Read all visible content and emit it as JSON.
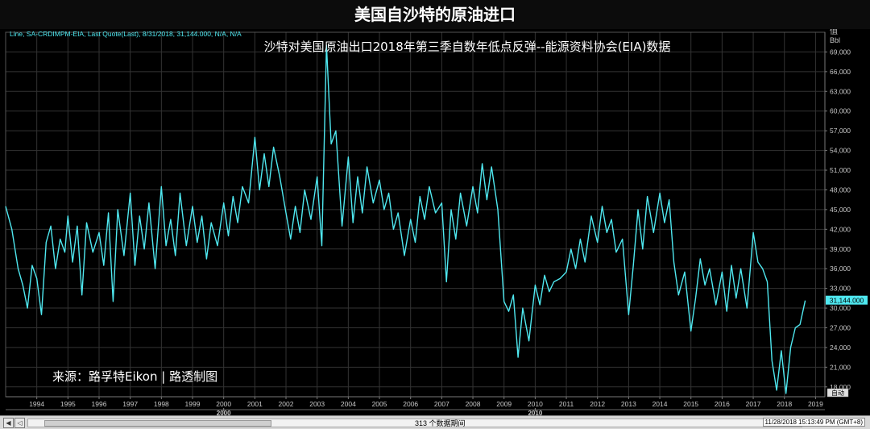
{
  "title": "美国自沙特的原油进口",
  "legend": "Line, SA-CRDIMPM-EIA, Last Quote(Last), 8/31/2018, 31,144.000, N/A, N/A",
  "subtitle": "沙特对美国原油出口2018年第三季自数年低点反弹--能源资料协会(EIA)数据",
  "source": "来源：路孚特Eikon | 路透制图",
  "y_unit_1": "值",
  "y_unit_2": "Bbl",
  "auto_label": "自动",
  "last_value_label": "31,144.000",
  "decades": [
    {
      "label": "1990",
      "year": 1990
    },
    {
      "label": "2000",
      "year": 2000
    },
    {
      "label": "2010",
      "year": 2010
    }
  ],
  "footer": {
    "points_label": "313 个数据期间",
    "timestamp": "11/28/2018 15:13:49 PM (GMT+8)"
  },
  "colors": {
    "line": "#4fe8f0",
    "background": "#000000",
    "grid": "#333333",
    "text": "#ffffff",
    "axis_text": "#c8c8c8",
    "legend_text": "#4fe8f0"
  },
  "chart_data": {
    "type": "line",
    "title": "美国自沙特的原油进口",
    "subtitle": "沙特对美国原油出口2018年第三季自数年低点反弹--能源资料协会(EIA)数据",
    "series": [
      {
        "name": "SA-CRDIMPM-EIA"
      }
    ],
    "ylabel": "值 Bbl",
    "ylim": [
      16500,
      72000
    ],
    "yticks": [
      18000,
      21000,
      24000,
      27000,
      30000,
      33000,
      36000,
      39000,
      42000,
      45000,
      48000,
      51000,
      54000,
      57000,
      60000,
      63000,
      66000,
      69000
    ],
    "ytick_labels": [
      "18,000",
      "21,000",
      "24,000",
      "27,000",
      "30,000",
      "33,000",
      "36,000",
      "39,000",
      "42,000",
      "45,000",
      "48,000",
      "51,000",
      "54,000",
      "57,000",
      "60,000",
      "63,000",
      "66,000",
      "69,000"
    ],
    "xlim": [
      1993.0,
      2019.3
    ],
    "xticks": [
      1994,
      1995,
      1996,
      1997,
      1998,
      1999,
      2000,
      2001,
      2002,
      2003,
      2004,
      2005,
      2006,
      2007,
      2008,
      2009,
      2010,
      2011,
      2012,
      2013,
      2014,
      2015,
      2016,
      2017,
      2018,
      2019
    ],
    "xtick_labels": [
      "1994",
      "1995",
      "1996",
      "1997",
      "1998",
      "1999",
      "2000",
      "2001",
      "2002",
      "2003",
      "2004",
      "2005",
      "2006",
      "2007",
      "2008",
      "2009",
      "2010",
      "2011",
      "2012",
      "2013",
      "2014",
      "2015",
      "2016",
      "2017",
      "2018",
      "2019"
    ],
    "grid": true,
    "last_value": 31144,
    "points": [
      [
        1993.0,
        45500
      ],
      [
        1993.2,
        42000
      ],
      [
        1993.4,
        36000
      ],
      [
        1993.55,
        33500
      ],
      [
        1993.7,
        30000
      ],
      [
        1993.85,
        36500
      ],
      [
        1994.0,
        34500
      ],
      [
        1994.15,
        29000
      ],
      [
        1994.3,
        40000
      ],
      [
        1994.45,
        42500
      ],
      [
        1994.6,
        36000
      ],
      [
        1994.75,
        40500
      ],
      [
        1994.9,
        38500
      ],
      [
        1995.0,
        44000
      ],
      [
        1995.15,
        37000
      ],
      [
        1995.3,
        42500
      ],
      [
        1995.45,
        32000
      ],
      [
        1995.6,
        43000
      ],
      [
        1995.8,
        38500
      ],
      [
        1996.0,
        41500
      ],
      [
        1996.15,
        36500
      ],
      [
        1996.3,
        44500
      ],
      [
        1996.45,
        31000
      ],
      [
        1996.6,
        45000
      ],
      [
        1996.8,
        38000
      ],
      [
        1997.0,
        47500
      ],
      [
        1997.15,
        36500
      ],
      [
        1997.3,
        44000
      ],
      [
        1997.45,
        39000
      ],
      [
        1997.6,
        46000
      ],
      [
        1997.8,
        36000
      ],
      [
        1998.0,
        48500
      ],
      [
        1998.15,
        39500
      ],
      [
        1998.3,
        43500
      ],
      [
        1998.45,
        38000
      ],
      [
        1998.6,
        47500
      ],
      [
        1998.8,
        39500
      ],
      [
        1999.0,
        45500
      ],
      [
        1999.15,
        40000
      ],
      [
        1999.3,
        44000
      ],
      [
        1999.45,
        37500
      ],
      [
        1999.6,
        43000
      ],
      [
        1999.8,
        39500
      ],
      [
        2000.0,
        46000
      ],
      [
        2000.15,
        41000
      ],
      [
        2000.3,
        47000
      ],
      [
        2000.45,
        43000
      ],
      [
        2000.6,
        48500
      ],
      [
        2000.8,
        46000
      ],
      [
        2001.0,
        56000
      ],
      [
        2001.15,
        48000
      ],
      [
        2001.3,
        53500
      ],
      [
        2001.45,
        48500
      ],
      [
        2001.6,
        54500
      ],
      [
        2001.8,
        50000
      ],
      [
        2002.0,
        44500
      ],
      [
        2002.15,
        40500
      ],
      [
        2002.3,
        45500
      ],
      [
        2002.45,
        41500
      ],
      [
        2002.6,
        48000
      ],
      [
        2002.8,
        43500
      ],
      [
        2003.0,
        50000
      ],
      [
        2003.15,
        39500
      ],
      [
        2003.3,
        70000
      ],
      [
        2003.45,
        55000
      ],
      [
        2003.6,
        57000
      ],
      [
        2003.8,
        42500
      ],
      [
        2004.0,
        53000
      ],
      [
        2004.15,
        43000
      ],
      [
        2004.3,
        50000
      ],
      [
        2004.45,
        44500
      ],
      [
        2004.6,
        51500
      ],
      [
        2004.8,
        46000
      ],
      [
        2005.0,
        49500
      ],
      [
        2005.15,
        45000
      ],
      [
        2005.3,
        47500
      ],
      [
        2005.45,
        42000
      ],
      [
        2005.6,
        44500
      ],
      [
        2005.8,
        38000
      ],
      [
        2006.0,
        43500
      ],
      [
        2006.15,
        40000
      ],
      [
        2006.3,
        47000
      ],
      [
        2006.45,
        43500
      ],
      [
        2006.6,
        48500
      ],
      [
        2006.8,
        44500
      ],
      [
        2007.0,
        46000
      ],
      [
        2007.15,
        34000
      ],
      [
        2007.3,
        45000
      ],
      [
        2007.45,
        40500
      ],
      [
        2007.6,
        47500
      ],
      [
        2007.8,
        42500
      ],
      [
        2008.0,
        48500
      ],
      [
        2008.15,
        44500
      ],
      [
        2008.3,
        52000
      ],
      [
        2008.45,
        46500
      ],
      [
        2008.6,
        51500
      ],
      [
        2008.8,
        45000
      ],
      [
        2009.0,
        31000
      ],
      [
        2009.15,
        29500
      ],
      [
        2009.3,
        32000
      ],
      [
        2009.45,
        22500
      ],
      [
        2009.6,
        30000
      ],
      [
        2009.8,
        25000
      ],
      [
        2010.0,
        33500
      ],
      [
        2010.15,
        30500
      ],
      [
        2010.3,
        35000
      ],
      [
        2010.45,
        32500
      ],
      [
        2010.6,
        34000
      ],
      [
        2010.8,
        34500
      ],
      [
        2011.0,
        35500
      ],
      [
        2011.15,
        39000
      ],
      [
        2011.3,
        36000
      ],
      [
        2011.45,
        40500
      ],
      [
        2011.6,
        37000
      ],
      [
        2011.8,
        44000
      ],
      [
        2012.0,
        40000
      ],
      [
        2012.15,
        45500
      ],
      [
        2012.3,
        41500
      ],
      [
        2012.45,
        43500
      ],
      [
        2012.6,
        38500
      ],
      [
        2012.8,
        40500
      ],
      [
        2013.0,
        29000
      ],
      [
        2013.15,
        36500
      ],
      [
        2013.3,
        45000
      ],
      [
        2013.45,
        39000
      ],
      [
        2013.6,
        47000
      ],
      [
        2013.8,
        41500
      ],
      [
        2014.0,
        47500
      ],
      [
        2014.15,
        43000
      ],
      [
        2014.3,
        46500
      ],
      [
        2014.45,
        37000
      ],
      [
        2014.6,
        32000
      ],
      [
        2014.8,
        35500
      ],
      [
        2015.0,
        26500
      ],
      [
        2015.15,
        31500
      ],
      [
        2015.3,
        37500
      ],
      [
        2015.45,
        33500
      ],
      [
        2015.6,
        36000
      ],
      [
        2015.8,
        30500
      ],
      [
        2016.0,
        35500
      ],
      [
        2016.15,
        29500
      ],
      [
        2016.3,
        36500
      ],
      [
        2016.45,
        31500
      ],
      [
        2016.6,
        36000
      ],
      [
        2016.8,
        30000
      ],
      [
        2017.0,
        41500
      ],
      [
        2017.15,
        37000
      ],
      [
        2017.3,
        36000
      ],
      [
        2017.45,
        34000
      ],
      [
        2017.6,
        22000
      ],
      [
        2017.75,
        17500
      ],
      [
        2017.9,
        23500
      ],
      [
        2018.05,
        17000
      ],
      [
        2018.2,
        24000
      ],
      [
        2018.35,
        27000
      ],
      [
        2018.5,
        27500
      ],
      [
        2018.67,
        31144
      ]
    ]
  }
}
